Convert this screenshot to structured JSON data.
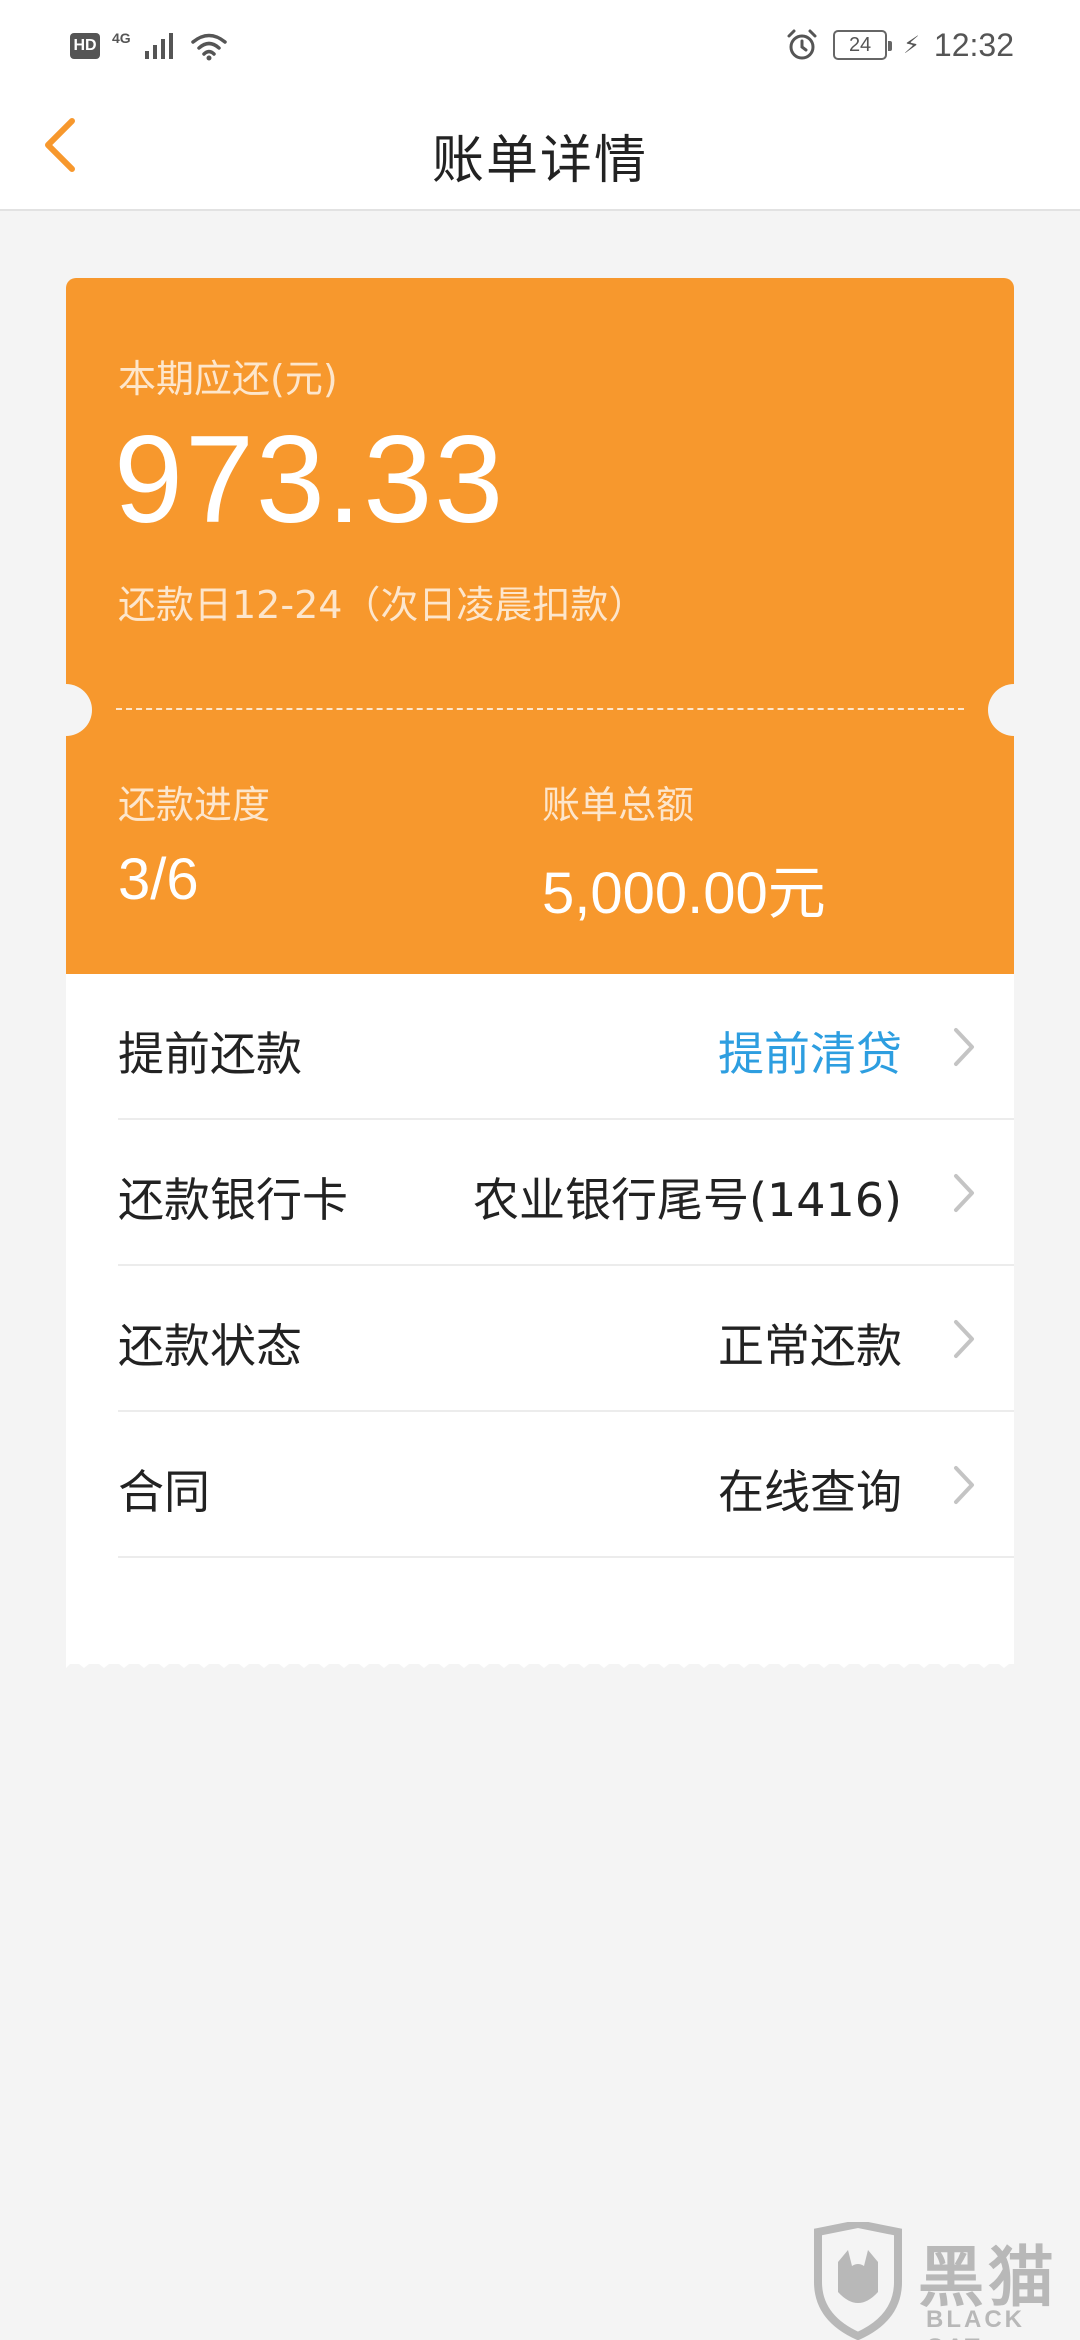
{
  "status_bar": {
    "hd": "HD",
    "network": "4G",
    "battery": "24",
    "time": "12:32"
  },
  "header": {
    "title": "账单详情",
    "back_icon": "chevron-left-icon"
  },
  "summary": {
    "due_label": "本期应还(元)",
    "due_amount": "973.33",
    "due_date": "还款日12-24（次日凌晨扣款）",
    "progress_label": "还款进度",
    "progress_value": "3/6",
    "total_label": "账单总额",
    "total_value": "5,000.00元"
  },
  "rows": [
    {
      "label": "提前还款",
      "value": "提前清贷",
      "value_is_link": true
    },
    {
      "label": "还款银行卡",
      "value": "农业银行尾号(1416)"
    },
    {
      "label": "还款状态",
      "value": "正常还款"
    },
    {
      "label": "合同",
      "value": "在线查询"
    }
  ],
  "watermark": {
    "cn": "黑猫",
    "en": "BLACK CAT"
  },
  "colors": {
    "accent_orange": "#f7982d",
    "link_blue": "#2d9ee0",
    "background": "#f4f4f4"
  }
}
